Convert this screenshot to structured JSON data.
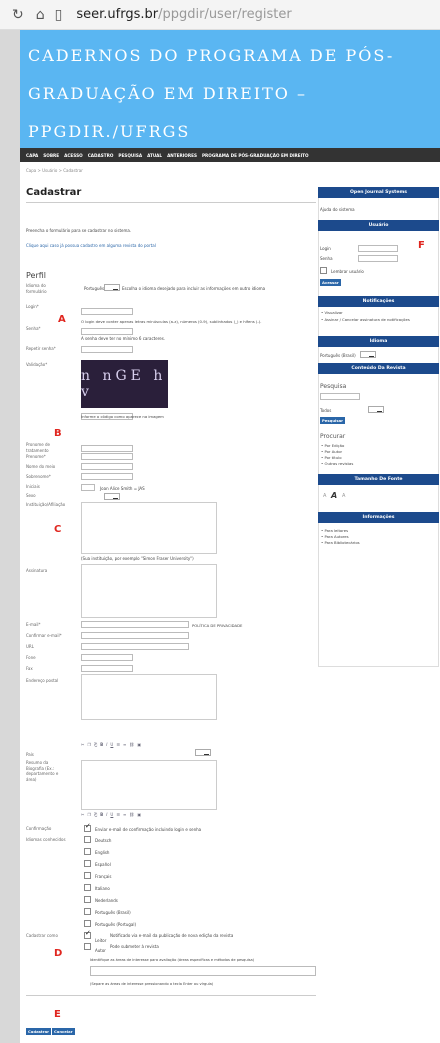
{
  "browser": {
    "url_host": "seer.ufrgs.br",
    "url_path": "/ppgdir/user/register"
  },
  "banner": {
    "line1": "CADERNOS DO PROGRAMA DE PÓS-",
    "line2": "GRADUAÇÃO EM DIREITO –",
    "line3": "PPGDIR./UFRGS"
  },
  "nav": [
    "CAPA",
    "SOBRE",
    "ACESSO",
    "CADASTRO",
    "PESQUISA",
    "ATUAL",
    "ANTERIORES",
    "PROGRAMA DE PÓS-GRADUAÇÃO EM DIREITO"
  ],
  "breadcrumb": "Capa > Usuário > Cadastrar",
  "page_title": "Cadastrar",
  "intro1": "Preencha o formulário para se cadastrar no sistema.",
  "intro2": "Clique aqui caso já possua cadastro em alguma revista do portal",
  "section_profile": "Perfil",
  "markers": {
    "a": "A",
    "b": "B",
    "c": "C",
    "d": "D",
    "e": "E",
    "f": "F"
  },
  "labels": {
    "form_lang": "Idioma do formulário",
    "login": "Login*",
    "senha": "Senha*",
    "repetir": "Repetir senha*",
    "validacao": "Validação*",
    "pronome": "Pronome de tratamento",
    "prenome": "Prenome*",
    "nome_meio": "Nome do meio",
    "sobrenome": "Sobrenome*",
    "iniciais": "Iniciais",
    "sexo": "Sexo",
    "instituicao": "Instituição/Afiliação",
    "assinatura": "Assinatura",
    "email": "E-mail*",
    "confirm_email": "Confirmar e-mail*",
    "url": "URL",
    "fone": "Fone",
    "fax": "Fax",
    "endereco": "Endereço postal",
    "pais": "País",
    "resumo": "Resumo da Biografia (Ex.: departamento e área)",
    "confirmacao": "Confirmação",
    "idiomas": "Idiomas conhecidos",
    "cadastrar_como": "Cadastrar como"
  },
  "values": {
    "form_lang": "Português (Brasil)",
    "iniciais_hint": "Joan Alice Smith = JAS",
    "captcha": "n nGE h v"
  },
  "hints": {
    "form_lang": "Escolha o idioma desejado para incluir as informações em outro idioma",
    "login": "O login deve conter apenas letras minúsculas (a-z), números (0-9), sublinhados (_) e hífens (-).",
    "senha": "A senha deve ter no mínimo 6 caracteres.",
    "captcha": "Informe o código como aparece na imagem",
    "instituicao": "(Sua instituição, por exemplo \"Simon Fraser University\")",
    "email_policy": "POLÍTICA DE PRIVACIDADE",
    "confirmacao": "Enviar e-mail de confirmação incluindo login e senha",
    "leitor": "Notificado via e-mail da publicação de nova edição da revista",
    "autor": "Pode submeter à revista",
    "interesses1": "Identifique as áreas de interesse para avaliação (áreas específicas e métodos de pesquisa)",
    "interesses2": "(Separe as áreas de interesse pressionando a tecla Enter ou vírgula)"
  },
  "roles": {
    "leitor": "Leitor",
    "autor": "Autor"
  },
  "languages": [
    "Deutsch",
    "English",
    "Español",
    "Français",
    "Italiano",
    "Nederlands",
    "Português (Brasil)",
    "Português (Portugal)"
  ],
  "buttons": {
    "cadastrar": "Cadastrar",
    "cancelar": "Cancelar"
  },
  "sidebar": {
    "ojs_title": "Open Journal Systems",
    "ojs_help": "Ajuda do sistema",
    "usuario_title": "Usuário",
    "login_label": "Login",
    "senha_label": "Senha",
    "lembrar": "Lembrar usuário",
    "acessar": "Acessar",
    "notif_title": "Notificações",
    "notif_items": [
      "Visualizar",
      "Assinar / Cancelar assinatura de notificações"
    ],
    "idioma_title": "Idioma",
    "idioma_value": "Português (Brasil)",
    "conteudo_title": "Conteúdo Da Revista",
    "pesquisa": "Pesquisa",
    "scope_value": "Todos",
    "pesquisar": "Pesquisar",
    "procurar": "Procurar",
    "procurar_items": [
      "Por Edição",
      "Por Autor",
      "Por título",
      "Outras revistas"
    ],
    "fonte_title": "Tamanho De Fonte",
    "font_sizes": [
      "A",
      "A",
      "A"
    ],
    "info_title": "Informações",
    "info_items": [
      "Para leitores",
      "Para Autores",
      "Para Bibliotecários"
    ]
  }
}
